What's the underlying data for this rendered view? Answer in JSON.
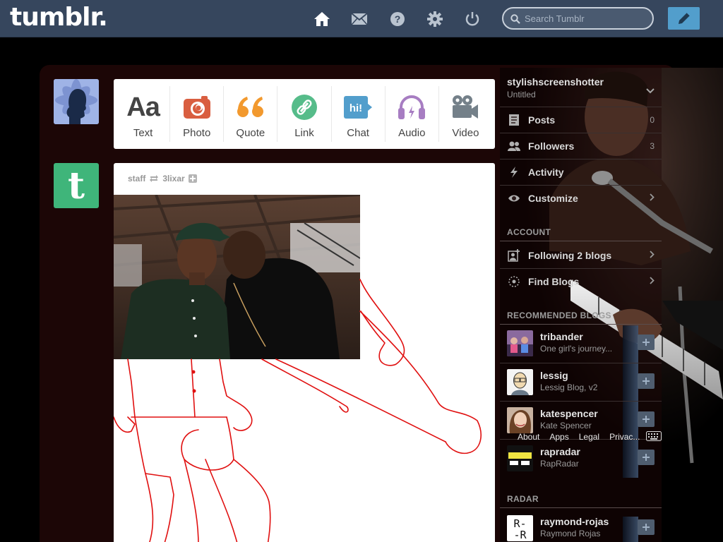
{
  "header": {
    "logo": "tumblr.",
    "search_placeholder": "Search Tumblr",
    "brand_color": "#36465d",
    "compose_color": "#529ecc",
    "nav": [
      {
        "name": "home-icon"
      },
      {
        "name": "mail-icon"
      },
      {
        "name": "help-icon"
      },
      {
        "name": "settings-gear-icon"
      },
      {
        "name": "power-icon"
      }
    ]
  },
  "post_types": [
    {
      "label": "Text",
      "icon": "text-aa-icon",
      "color": "#444444"
    },
    {
      "label": "Photo",
      "icon": "camera-icon",
      "color": "#d95e40"
    },
    {
      "label": "Quote",
      "icon": "quote-icon",
      "color": "#f2992e"
    },
    {
      "label": "Link",
      "icon": "link-icon",
      "color": "#56bc8a"
    },
    {
      "label": "Chat",
      "icon": "chat-icon",
      "color": "#529ecc"
    },
    {
      "label": "Audio",
      "icon": "headphones-icon",
      "color": "#a77dc2"
    },
    {
      "label": "Video",
      "icon": "video-camera-icon",
      "color": "#748089"
    }
  ],
  "post": {
    "author": "staff",
    "reblogged_from": "3lixar"
  },
  "sidebar": {
    "blog_name": "stylishscreenshotter",
    "blog_title": "Untitled",
    "stats": [
      {
        "label": "Posts",
        "count": "0",
        "icon": "posts-icon"
      },
      {
        "label": "Followers",
        "count": "3",
        "icon": "followers-icon"
      },
      {
        "label": "Activity",
        "count": "",
        "icon": "activity-bolt-icon"
      },
      {
        "label": "Customize",
        "count": "",
        "icon": "eye-icon"
      }
    ],
    "account_title": "ACCOUNT",
    "account": [
      {
        "label": "Following 2 blogs",
        "icon": "following-icon"
      },
      {
        "label": "Find Blogs",
        "icon": "find-blogs-icon"
      }
    ],
    "recommended_title": "RECOMMENDED BLOGS",
    "recommended": [
      {
        "name": "tribander",
        "desc": "One girl's journey..."
      },
      {
        "name": "lessig",
        "desc": "Lessig Blog, v2"
      },
      {
        "name": "katespencer",
        "desc": "Kate Spencer"
      },
      {
        "name": "rapradar",
        "desc": "RapRadar"
      }
    ],
    "footer": [
      "About",
      "Apps",
      "Legal",
      "Privac..."
    ],
    "radar_title": "RADAR",
    "radar": {
      "name": "raymond-rojas",
      "desc": "Raymond Rojas",
      "avatar_text": "R-\n-R"
    }
  }
}
